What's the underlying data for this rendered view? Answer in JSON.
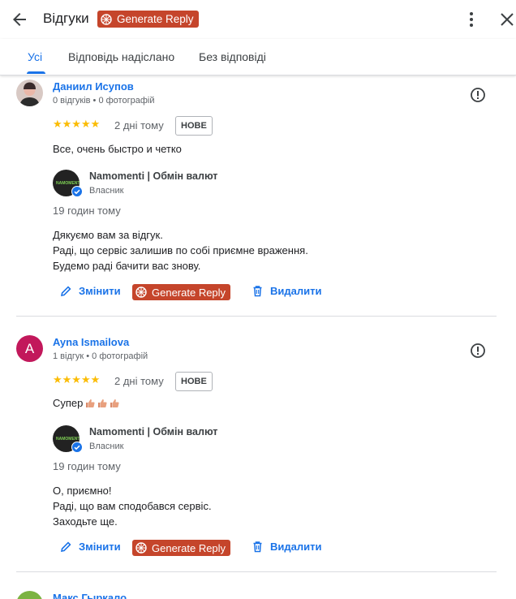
{
  "header": {
    "title": "Відгуки",
    "generate_label": "Generate Reply"
  },
  "tabs": [
    {
      "label": "Усі",
      "active": true
    },
    {
      "label": "Відповідь надіслано",
      "active": false
    },
    {
      "label": "Без відповіді",
      "active": false
    }
  ],
  "reviews": [
    {
      "author": "Даниил Исупов",
      "meta": "0 відгуків • 0 фотографій",
      "stars": "★★★★★",
      "rating": 5,
      "time": "2 дні тому",
      "badge": "НОВЕ",
      "text": "Все, очень быстро и четко",
      "owner": {
        "name": "Namomenti | Обмін валют",
        "role": "Власник",
        "time": "19 годин тому",
        "reply": [
          "Дякуємо вам за відгук.",
          "Раді, що сервіс залишив по собі приємне враження.",
          "Будемо раді бачити вас знову."
        ]
      },
      "actions": {
        "edit": "Змінити",
        "generate": "Generate Reply",
        "delete": "Видалити"
      }
    },
    {
      "author": "Ayna Ismailova",
      "avatar_letter": "A",
      "meta": "1 відгук • 0 фотографій",
      "stars": "★★★★★",
      "rating": 5,
      "time": "2 дні тому",
      "badge": "НОВЕ",
      "text": "Супер",
      "text_emoji": [
        "thumbs-up-icon",
        "thumbs-up-icon",
        "thumbs-up-icon"
      ],
      "owner": {
        "name": "Namomenti | Обмін валют",
        "role": "Власник",
        "time": "19 годин тому",
        "reply": [
          "О, приємно!",
          "Раді, що вам сподобався сервіс.",
          "Заходьте ще."
        ]
      },
      "actions": {
        "edit": "Змінити",
        "generate": "Generate Reply",
        "delete": "Видалити"
      }
    },
    {
      "author": "Макс Гыркало"
    }
  ],
  "colors": {
    "accent": "#1a73e8",
    "generate_bg": "#c5452b",
    "star": "#fbbc04",
    "avatar_pink": "#c2185b",
    "avatar_green": "#7cb342"
  }
}
